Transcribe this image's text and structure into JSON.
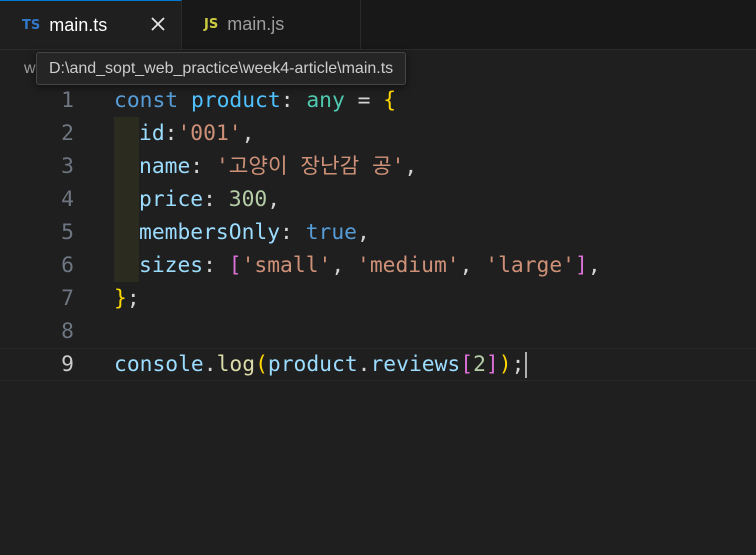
{
  "tabs": [
    {
      "icon": "TS",
      "label": "main.ts",
      "active": true,
      "close": "✕"
    },
    {
      "icon": "JS",
      "label": "main.js",
      "active": false
    }
  ],
  "breadcrumb": {
    "fragment": "w"
  },
  "tooltip": {
    "path": "D:\\and_sopt_web_practice\\week4-article\\main.ts"
  },
  "editor": {
    "line_numbers": [
      "1",
      "2",
      "3",
      "4",
      "5",
      "6",
      "7",
      "8",
      "9"
    ],
    "current_line": "9",
    "lines": [
      [
        {
          "t": "kw",
          "v": "const "
        },
        {
          "t": "var",
          "v": "product"
        },
        {
          "t": "op",
          "v": ": "
        },
        {
          "t": "type",
          "v": "any"
        },
        {
          "t": "op",
          "v": " = "
        },
        {
          "t": "p1",
          "v": "{"
        }
      ],
      [
        {
          "t": "prop",
          "v": "id"
        },
        {
          "t": "op",
          "v": ":"
        },
        {
          "t": "str",
          "v": "'001'"
        },
        {
          "t": "op",
          "v": ","
        }
      ],
      [
        {
          "t": "prop",
          "v": "name"
        },
        {
          "t": "op",
          "v": ": "
        },
        {
          "t": "str",
          "v": "'고양이 장난감 공'"
        },
        {
          "t": "op",
          "v": ","
        }
      ],
      [
        {
          "t": "prop",
          "v": "price"
        },
        {
          "t": "op",
          "v": ": "
        },
        {
          "t": "num",
          "v": "300"
        },
        {
          "t": "op",
          "v": ","
        }
      ],
      [
        {
          "t": "prop",
          "v": "membersOnly"
        },
        {
          "t": "op",
          "v": ": "
        },
        {
          "t": "kw",
          "v": "true"
        },
        {
          "t": "op",
          "v": ","
        }
      ],
      [
        {
          "t": "prop",
          "v": "sizes"
        },
        {
          "t": "op",
          "v": ": "
        },
        {
          "t": "p2",
          "v": "["
        },
        {
          "t": "str",
          "v": "'small'"
        },
        {
          "t": "op",
          "v": ", "
        },
        {
          "t": "str",
          "v": "'medium'"
        },
        {
          "t": "op",
          "v": ", "
        },
        {
          "t": "str",
          "v": "'large'"
        },
        {
          "t": "p2",
          "v": "]"
        },
        {
          "t": "op",
          "v": ","
        }
      ],
      [
        {
          "t": "p1",
          "v": "}"
        },
        {
          "t": "op",
          "v": ";"
        }
      ],
      [],
      [
        {
          "t": "prop",
          "v": "console"
        },
        {
          "t": "op",
          "v": "."
        },
        {
          "t": "fn",
          "v": "log"
        },
        {
          "t": "p1",
          "v": "("
        },
        {
          "t": "prop",
          "v": "product"
        },
        {
          "t": "op",
          "v": "."
        },
        {
          "t": "prop",
          "v": "reviews"
        },
        {
          "t": "p2",
          "v": "["
        },
        {
          "t": "num",
          "v": "2"
        },
        {
          "t": "p2",
          "v": "]"
        },
        {
          "t": "p1",
          "v": ")"
        },
        {
          "t": "op",
          "v": ";"
        }
      ]
    ],
    "indented_lines": [
      2,
      3,
      4,
      5,
      6
    ]
  },
  "colors": {
    "background": "#1f1f1f",
    "ts_icon": "#3178c6",
    "js_icon": "#cbcb41",
    "keyword": "#569cd6",
    "string": "#ce9178",
    "number": "#b5cea8"
  },
  "icons": {
    "close": "close-icon",
    "ts": "ts-file-icon",
    "js": "js-file-icon"
  }
}
